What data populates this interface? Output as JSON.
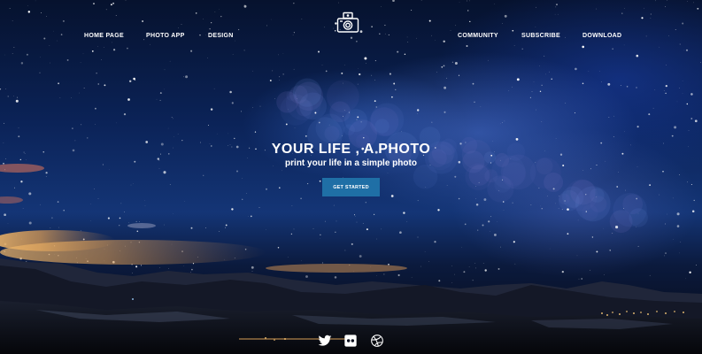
{
  "nav": {
    "left": [
      {
        "label": "HOME PAGE"
      },
      {
        "label": "PHOTO APP"
      },
      {
        "label": "DESIGN"
      }
    ],
    "right": [
      {
        "label": "COMMUNITY"
      },
      {
        "label": "SUBSCRIBE"
      },
      {
        "label": "DOWNLOAD"
      }
    ],
    "logo_icon": "camera-icon"
  },
  "hero": {
    "headline": "YOUR LIFE , A PHOTO",
    "subheadline": "print your life in a simple photo",
    "cta_label": "GET STARTED",
    "background": "night-sky-milky-way-over-mountains"
  },
  "social": [
    {
      "icon": "twitter-icon"
    },
    {
      "icon": "flickr-icon"
    },
    {
      "icon": "dribbble-icon"
    }
  ],
  "colors": {
    "accent": "#1f6fa6",
    "text": "#ffffff",
    "sky": "#0b2358"
  }
}
